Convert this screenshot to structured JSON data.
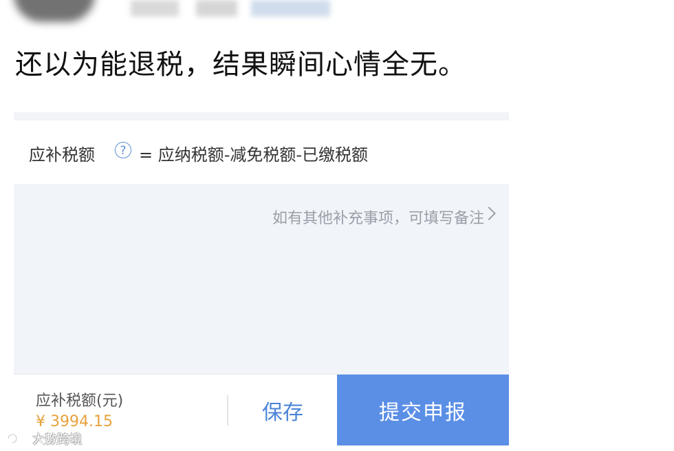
{
  "post": {
    "text": "还以为能退税，结果瞬间心情全无。"
  },
  "app": {
    "formula": {
      "label": "应补税额",
      "help_icon": "?",
      "text": "= 应纳税额-减免税额-已缴税额"
    },
    "note_link": "如有其他补充事项，可填写备注",
    "bottom": {
      "due_label": "应补税额(元)",
      "due_amount": "¥ 3994.15",
      "save_label": "保存",
      "submit_label": "提交申报"
    },
    "colors": {
      "accent": "#5b8fe6",
      "amount": "#e6a23c",
      "link": "#4b84d8"
    }
  },
  "watermark": {
    "text": "大數跨境"
  }
}
